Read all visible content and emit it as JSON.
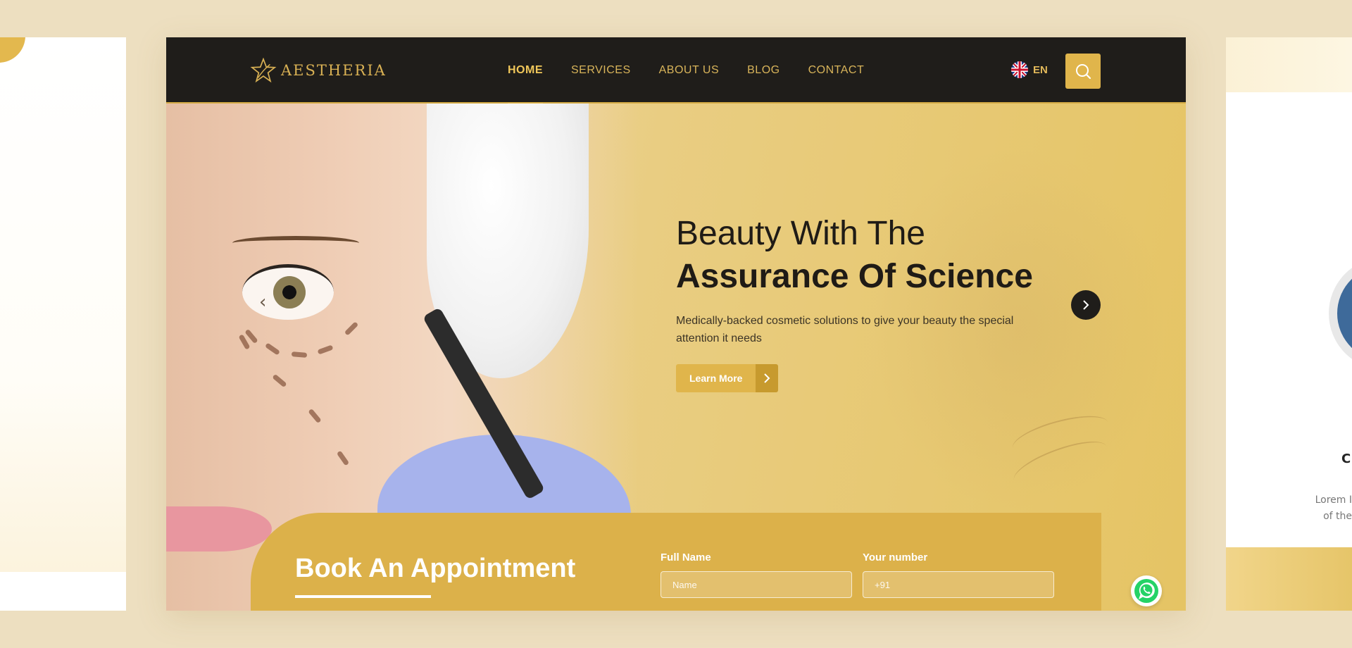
{
  "brand": {
    "name": "AESTHERIA"
  },
  "nav": {
    "items": [
      {
        "label": "HOME",
        "active": true
      },
      {
        "label": "SERVICES",
        "active": false
      },
      {
        "label": "ABOUT US",
        "active": false
      },
      {
        "label": "BLOG",
        "active": false
      },
      {
        "label": "CONTACT",
        "active": false
      }
    ],
    "language": "EN",
    "search_icon": "search-icon"
  },
  "hero": {
    "title_line1": "Beauty With The",
    "title_line2": "Assurance Of Science",
    "subtitle": "Medically-backed cosmetic solutions to give your beauty the special attention it needs",
    "cta_label": "Learn More"
  },
  "booking": {
    "title": "Book An Appointment",
    "fields": [
      {
        "label": "Full Name",
        "placeholder": "Name"
      },
      {
        "label": "Your number",
        "placeholder": "+91"
      }
    ]
  },
  "side_right": {
    "title_fragment": "C",
    "text_fragment": "Lorem I\nof the"
  },
  "colors": {
    "gold": "#e0b54b",
    "dark": "#1f1d1a",
    "background": "#eddfc0"
  }
}
